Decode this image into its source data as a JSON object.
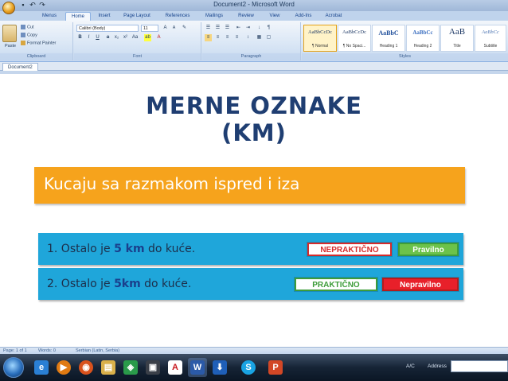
{
  "window": {
    "title": "Document2 - Microsoft Word"
  },
  "ribbon_tabs": [
    "Menus",
    "Home",
    "Insert",
    "Page Layout",
    "References",
    "Mailings",
    "Review",
    "View",
    "Add-Ins",
    "Acrobat"
  ],
  "active_tab_index": 1,
  "clipboard": {
    "paste": "Paste",
    "cut": "Cut",
    "copy": "Copy",
    "format_painter": "Format Painter",
    "label": "Clipboard"
  },
  "font_group": {
    "font_name": "Calibri (Body)",
    "font_size": "11",
    "label": "Font"
  },
  "paragraph_group": {
    "label": "Paragraph"
  },
  "styles_group": {
    "label": "Styles",
    "items": [
      {
        "sample": "AaBbCcDc",
        "name": "¶ Normal"
      },
      {
        "sample": "AaBbCcDc",
        "name": "¶ No Spaci..."
      },
      {
        "sample": "AaBbC",
        "name": "Heading 1"
      },
      {
        "sample": "AaBbCc",
        "name": "Heading 2"
      },
      {
        "sample": "AaB",
        "name": "Title"
      },
      {
        "sample": "AaBbCc",
        "name": "Subtitle"
      }
    ]
  },
  "document_tab": "Document2",
  "slide": {
    "title_line1": "MERNE OZNAKE",
    "title_line2": "(KM)",
    "subtitle": "Kucaju sa razmakom ispred i iza",
    "examples": [
      {
        "prefix": "1. Ostalo je ",
        "highlight": "5 km",
        "suffix": " do kuće.",
        "tag_left": "NEPRAKTIČNO",
        "tag_right": "Pravilno"
      },
      {
        "prefix": "2. Ostalo je ",
        "highlight": "5km",
        "suffix": " do kuće.",
        "tag_left": "PRAKTIČNO",
        "tag_right": "Nepravilno"
      }
    ]
  },
  "status_bar": {
    "page": "Page: 1 of 1",
    "words": "Words: 0",
    "language": "Serbian (Latin, Serbia)"
  },
  "taskbar": {
    "tray": "A/C",
    "address_label": "Address"
  },
  "colors": {
    "title": "#1f3e72",
    "subtitle_bar": "#f6a31c",
    "example_bar": "#1fa6da",
    "tag_red_border": "#d62b2b",
    "tag_red_fill": "#e8202a",
    "tag_green_fill": "#6cc24a",
    "tag_green_border": "#3e9d3a"
  }
}
